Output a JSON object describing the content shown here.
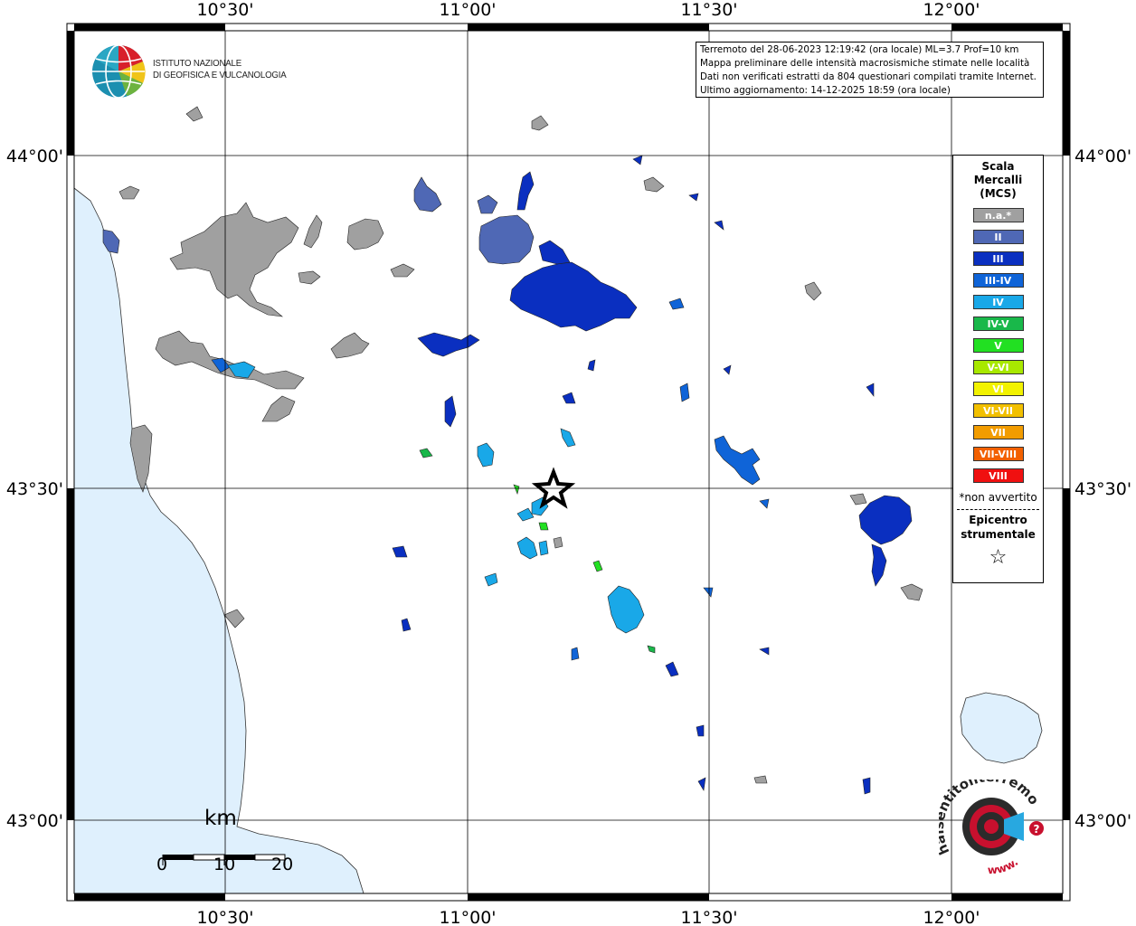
{
  "info": {
    "lines": [
      "Terremoto del 28-06-2023 12:19:42 (ora locale) ML=3.7 Prof=10 km",
      "Mappa preliminare delle intensità macrosismiche stimate nelle località",
      "Dati non verificati estratti da 804 questionari compilati tramite Internet.",
      "Ultimo aggiornamento: 14-12-2025 18:59 (ora locale)"
    ]
  },
  "axes": {
    "top_labels": [
      "10°30'",
      "11°00'",
      "11°30'",
      "12°00'"
    ],
    "bottom_labels": [
      "10°30'",
      "11°00'",
      "11°30'",
      "12°00'"
    ],
    "left_labels": [
      "44°00'",
      "43°30'",
      "43°00'"
    ],
    "right_labels": [
      "44°00'",
      "43°30'",
      "43°00'"
    ]
  },
  "logo_ingv": {
    "line1": "ISTITUTO NAZIONALE",
    "line2": "DI GEOFISICA E VULCANOLOGIA"
  },
  "logo_hst": {
    "text": "haisentitoilterremoto.it",
    "www": "www."
  },
  "legend": {
    "title": [
      "Scala",
      "Mercalli",
      "(MCS)"
    ],
    "items": [
      {
        "label": "n.a.*",
        "color": "#a0a0a0"
      },
      {
        "label": "II",
        "color": "#4f68b5"
      },
      {
        "label": "III",
        "color": "#0a2fc0"
      },
      {
        "label": "III-IV",
        "color": "#0f64d8"
      },
      {
        "label": "IV",
        "color": "#19a8e8"
      },
      {
        "label": "IV-V",
        "color": "#19b84a"
      },
      {
        "label": "V",
        "color": "#22e022"
      },
      {
        "label": "V-VI",
        "color": "#a8e800"
      },
      {
        "label": "VI",
        "color": "#f2f200"
      },
      {
        "label": "VI-VII",
        "color": "#f2c000"
      },
      {
        "label": "VII",
        "color": "#f29c00"
      },
      {
        "label": "VII-VIII",
        "color": "#f26000"
      },
      {
        "label": "VIII",
        "color": "#f01010"
      }
    ],
    "note": "*non avvertito",
    "epicenter": [
      "Epicentro",
      "strumentale"
    ]
  },
  "scalebar": {
    "unit": "km",
    "ticks": [
      "0",
      "10",
      "20"
    ]
  },
  "colors": {
    "sea": "#dff0fd",
    "grey": "#a0a0a0",
    "ii": "#4f68b5",
    "iii": "#0a2fc0",
    "iiiiv": "#0f64d8",
    "iv": "#19a8e8",
    "ivv": "#19b84a",
    "v": "#22e022"
  }
}
